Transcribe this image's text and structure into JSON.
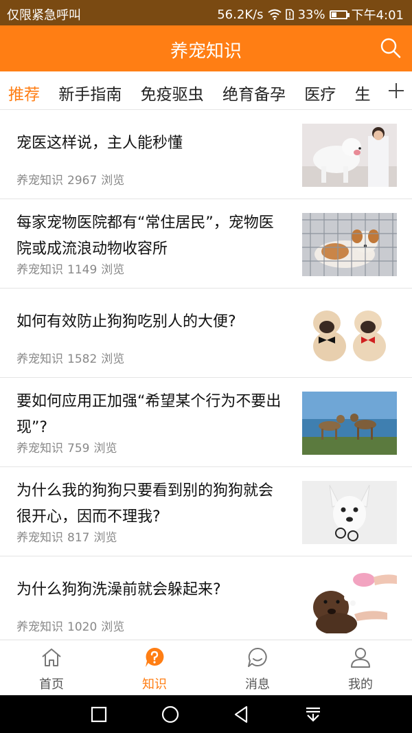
{
  "status_bar": {
    "carrier_text": "仅限紧急呼叫",
    "network_speed": "56.2K/s",
    "battery_percent": "33%",
    "battery_level": 0.33,
    "time": "下午4:01"
  },
  "header": {
    "title": "养宠知识"
  },
  "tabs": [
    {
      "label": "推荐",
      "active": true
    },
    {
      "label": "新手指南"
    },
    {
      "label": "免疫驱虫"
    },
    {
      "label": "绝育备孕"
    },
    {
      "label": "医疗"
    },
    {
      "label": "生"
    }
  ],
  "articles": [
    {
      "title": "宠医这样说，主人能秒懂",
      "source": "养宠知识",
      "views": "2967",
      "views_unit": "浏览",
      "image": "white-dog-with-vet"
    },
    {
      "title": "每家宠物医院都有“常住居民”，宠物医院或成流浪动物收容所",
      "source": "养宠知识",
      "views": "1149",
      "views_unit": "浏览",
      "image": "dog-in-cage"
    },
    {
      "title": "如何有效防止狗狗吃别人的大便?",
      "source": "养宠知识",
      "views": "1582",
      "views_unit": "浏览",
      "image": "two-pug-puppies"
    },
    {
      "title": "要如何应用正加强“希望某个行为不要出现”?",
      "source": "养宠知识",
      "views": "759",
      "views_unit": "浏览",
      "image": "dogs-on-beach"
    },
    {
      "title": "为什么我的狗狗只要看到别的狗狗就会很开心，因而不理我?",
      "source": "养宠知识",
      "views": "817",
      "views_unit": "浏览",
      "image": "chihuahua-with-glasses"
    },
    {
      "title": "为什么狗狗洗澡前就会躲起来?",
      "source": "养宠知识",
      "views": "1020",
      "views_unit": "浏览",
      "image": "brown-dog-bath"
    }
  ],
  "bottom_nav": [
    {
      "label": "首页",
      "icon": "home-icon"
    },
    {
      "label": "知识",
      "icon": "question-bubble-icon",
      "active": true
    },
    {
      "label": "消息",
      "icon": "chat-bubble-icon"
    },
    {
      "label": "我的",
      "icon": "person-icon"
    }
  ],
  "colors": {
    "brand": "#ff7e14",
    "status_bar": "#7a4a12"
  }
}
